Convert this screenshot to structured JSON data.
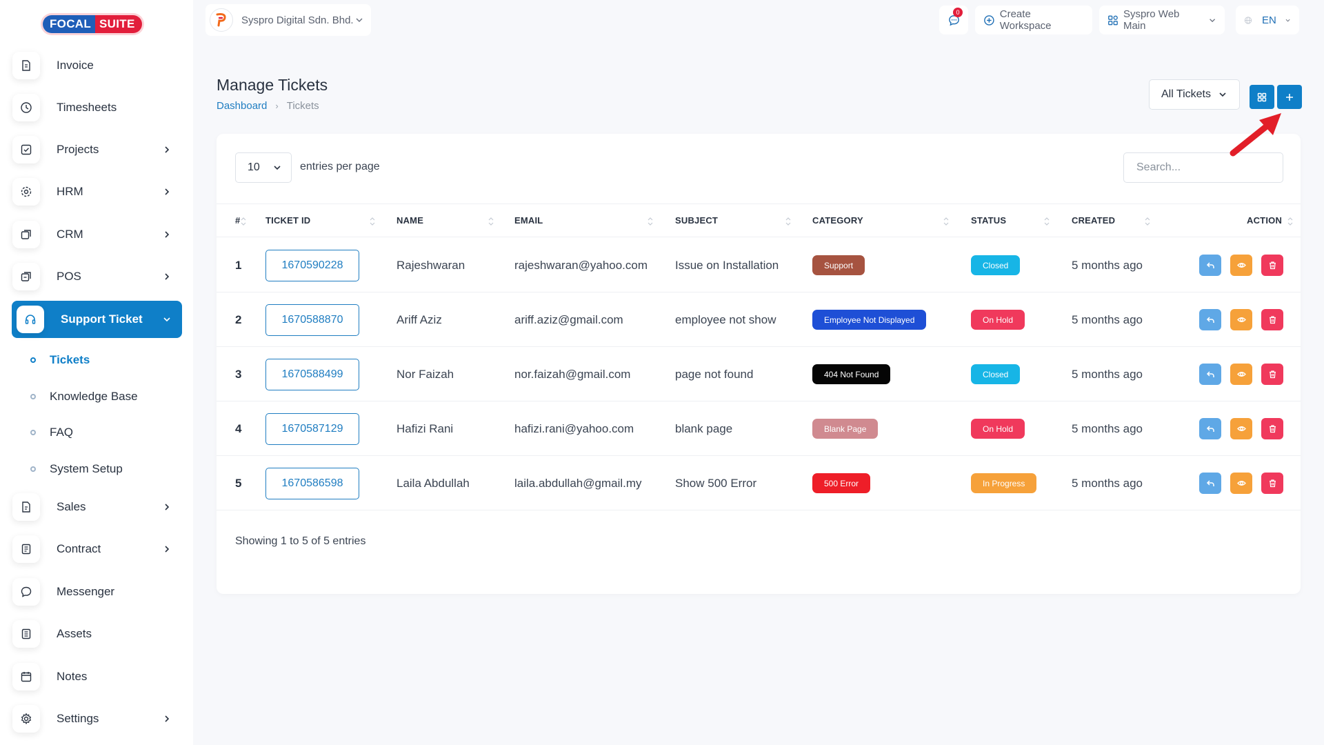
{
  "brand": {
    "part1": "FOCAL",
    "part2": "SUITE"
  },
  "sidebar": {
    "items": [
      {
        "label": "Invoice",
        "icon": "invoice-icon",
        "arrow": false
      },
      {
        "label": "Timesheets",
        "icon": "clock-icon",
        "arrow": false
      },
      {
        "label": "Projects",
        "icon": "projects-icon",
        "arrow": true
      },
      {
        "label": "HRM",
        "icon": "hrm-icon",
        "arrow": true
      },
      {
        "label": "CRM",
        "icon": "crm-icon",
        "arrow": true
      },
      {
        "label": "POS",
        "icon": "pos-icon",
        "arrow": true
      },
      {
        "label": "Support Ticket",
        "icon": "headset-icon",
        "arrow": true,
        "active": true
      },
      {
        "label": "Sales",
        "icon": "sales-icon",
        "arrow": true
      },
      {
        "label": "Contract",
        "icon": "contract-icon",
        "arrow": true
      },
      {
        "label": "Messenger",
        "icon": "messenger-icon",
        "arrow": false
      },
      {
        "label": "Assets",
        "icon": "assets-icon",
        "arrow": false
      },
      {
        "label": "Notes",
        "icon": "notes-icon",
        "arrow": false
      },
      {
        "label": "Settings",
        "icon": "gear-icon",
        "arrow": true
      }
    ],
    "subitems": [
      {
        "label": "Tickets",
        "active": true
      },
      {
        "label": "Knowledge Base"
      },
      {
        "label": "FAQ"
      },
      {
        "label": "System Setup"
      }
    ]
  },
  "header": {
    "company": "Syspro Digital Sdn. Bhd.",
    "notifications_count": "0",
    "create_workspace": "Create Workspace",
    "workspace": "Syspro Web Main",
    "language": "EN"
  },
  "page": {
    "title": "Manage Tickets",
    "breadcrumb": {
      "home": "Dashboard",
      "current": "Tickets"
    },
    "filter": "All Tickets"
  },
  "table": {
    "per_page": "10",
    "per_page_label": "entries per page",
    "search_placeholder": "Search...",
    "headers": [
      "#",
      "TICKET ID",
      "NAME",
      "EMAIL",
      "SUBJECT",
      "CATEGORY",
      "STATUS",
      "CREATED",
      "ACTION"
    ],
    "rows": [
      {
        "idx": "1",
        "ticket_id": "1670590228",
        "name": "Rajeshwaran",
        "email": "rajeshwaran@yahoo.com",
        "subject": "Issue on Installation",
        "category": "Support",
        "category_color": "#a65340",
        "status": "Closed",
        "status_color": "#17b5e6",
        "created": "5 months ago"
      },
      {
        "idx": "2",
        "ticket_id": "1670588870",
        "name": "Ariff Aziz",
        "email": "ariff.aziz@gmail.com",
        "subject": "employee not show",
        "category": "Employee Not Displayed",
        "category_color": "#1e4fd6",
        "status": "On Hold",
        "status_color": "#f0395c",
        "created": "5 months ago"
      },
      {
        "idx": "3",
        "ticket_id": "1670588499",
        "name": "Nor Faizah",
        "email": "nor.faizah@gmail.com",
        "subject": "page not found",
        "category": "404 Not Found",
        "category_color": "#050505",
        "status": "Closed",
        "status_color": "#17b5e6",
        "created": "5 months ago"
      },
      {
        "idx": "4",
        "ticket_id": "1670587129",
        "name": "Hafizi Rani",
        "email": "hafizi.rani@yahoo.com",
        "subject": "blank page",
        "category": "Blank Page",
        "category_color": "#d08a90",
        "status": "On Hold",
        "status_color": "#f0395c",
        "created": "5 months ago"
      },
      {
        "idx": "5",
        "ticket_id": "1670586598",
        "name": "Laila Abdullah",
        "email": "laila.abdullah@gmail.my",
        "subject": "Show 500 Error",
        "category": "500 Error",
        "category_color": "#ee1e28",
        "status": "In Progress",
        "status_color": "#f6a13a",
        "created": "5 months ago"
      }
    ],
    "footer": "Showing 1 to 5 of 5 entries"
  },
  "colors": {
    "primary": "#0f7fc8",
    "reply": "#5fa8e6",
    "view": "#f6a13a",
    "delete": "#f0395c"
  }
}
